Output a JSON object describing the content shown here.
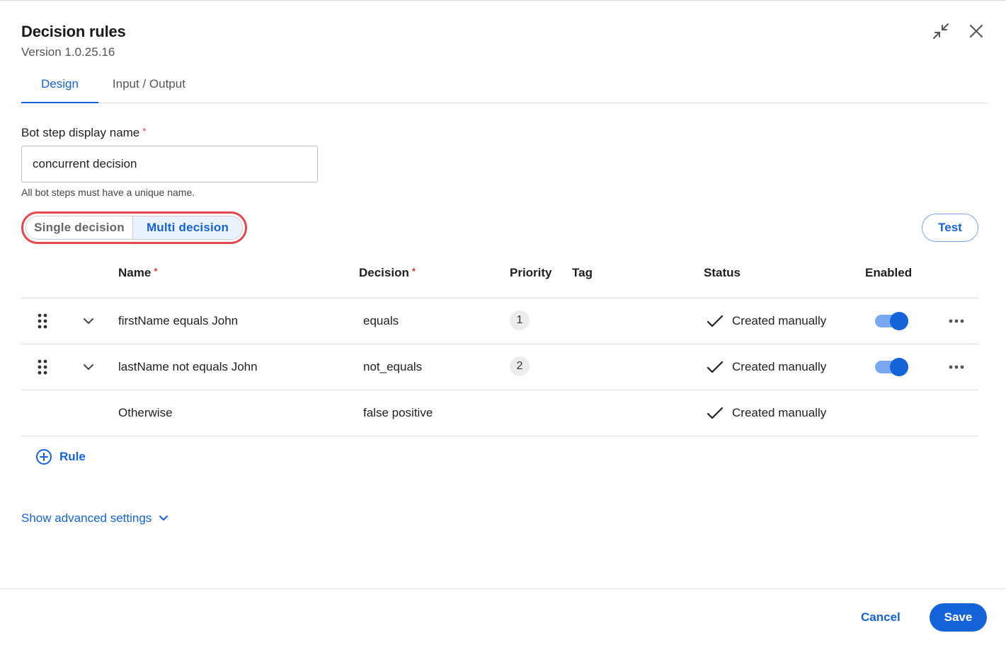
{
  "dialog": {
    "title": "Decision rules",
    "version": "Version 1.0.25.16",
    "icons": {
      "collapse": "collapse-icon",
      "close": "close-icon"
    }
  },
  "tabs": [
    {
      "label": "Design",
      "active": true
    },
    {
      "label": "Input / Output",
      "active": false
    }
  ],
  "bot_step": {
    "label": "Bot step display name",
    "required_mark": "*",
    "value": "concurrent decision",
    "helper": "All bot steps must have a unique name."
  },
  "mode": {
    "single_label": "Single decision",
    "multi_label": "Multi decision",
    "selected": "Multi decision"
  },
  "test_label": "Test",
  "table": {
    "headers": {
      "name": "Name",
      "decision": "Decision",
      "priority": "Priority",
      "tag": "Tag",
      "status": "Status",
      "enabled": "Enabled"
    },
    "required_mark": "*",
    "rows": [
      {
        "name": "firstName equals John",
        "decision": "equals",
        "priority": "1",
        "tag": "",
        "status": "Created manually",
        "enabled": true
      },
      {
        "name": "lastName not equals John",
        "decision": "not_equals",
        "priority": "2",
        "tag": "",
        "status": "Created manually",
        "enabled": true
      },
      {
        "name": "Otherwise",
        "decision": "false positive",
        "priority": "",
        "tag": "",
        "status": "Created manually"
      }
    ]
  },
  "add_rule_label": "Rule",
  "advanced_label": "Show advanced settings",
  "footer": {
    "cancel_label": "Cancel",
    "save_label": "Save"
  },
  "colors": {
    "accent": "#1463d9",
    "highlight_ring": "#e5484d",
    "required": "#d43b3b"
  }
}
